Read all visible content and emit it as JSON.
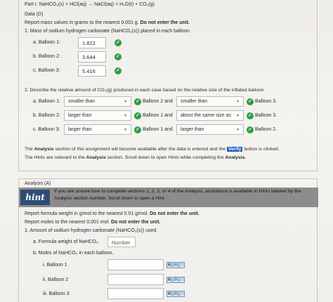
{
  "part1": {
    "heading": "Part I. NaHCO₃(s) + HCl(aq) → NaCl(aq) + H₂O(ℓ) + CO₂(g)",
    "data_label": "Data (D)",
    "report_prefix": "Report mass values in grams to the nearest 0.001 g.",
    "report_bold": "Do not enter the unit.",
    "q1": "1. Mass of sodium hydrogen carbonate (NaHCO₃(s)) placed in each balloon.",
    "masses": [
      {
        "label": "a. Balloon 1:",
        "value": "1.822"
      },
      {
        "label": "b. Balloon 2:",
        "value": "3.644"
      },
      {
        "label": "c. Balloon 3:",
        "value": "5.416"
      }
    ],
    "q2": "2. Describe the relative amount of CO₂(g) produced in each case based on the relative size of the inflated balloon.",
    "comparisons": [
      {
        "label": "a. Balloon 1:",
        "sel1": "smaller than",
        "ref1": "Balloon 2 and",
        "sel2": "smaller than",
        "ref2": "Balloon 3."
      },
      {
        "label": "b. Balloon 2:",
        "sel1": "larger than",
        "ref1": "Balloon 1 and",
        "sel2": "about the same size as",
        "ref2": "Balloon 3."
      },
      {
        "label": "c. Balloon 3:",
        "sel1": "larger than",
        "ref1": "Balloon 1 and",
        "sel2": "larger than",
        "ref2": "Balloon 2."
      }
    ],
    "analysis_note_1a": "The",
    "analysis_note_1b": "Analysis",
    "analysis_note_1c": "section of this assignment will become available after the data is entered and the",
    "verify_label": "Verify",
    "analysis_note_1d": "button is clicked.",
    "analysis_note_2a": "The Hints are relevant to the",
    "analysis_note_2b": "Analysis",
    "analysis_note_2c": "section.  Scroll down to open Hints while completing the",
    "analysis_note_2d": "Analysis."
  },
  "analysis": {
    "heading": "Analysis (A)",
    "hint_logo": "hint",
    "hint_line1": "If you are unsure how to complete sections 1, 2, 3, or 4 of the Analysis, assistance is available in Hints labeled by the",
    "hint_line2": "Analysis section number. Scroll down to open a Hint.",
    "fw_prefix": "Report formula weight in g/mol to the nearest 0.01 g/mol.",
    "fw_bold": "Do not enter the unit.",
    "mol_prefix": "Report moles to the nearest 0.001 mol.",
    "mol_bold": "Do not enter the unit.",
    "q1": "1. Amount of sodium hydrogen carbonate (NaHCO₃(s)) used.",
    "fw_label": "a. Formula weight of NaHCO₃",
    "fw_placeholder": "Number",
    "moles_label": "b. Moles of NaHCO₃ in each balloon.",
    "balloons": [
      {
        "label": "i. Balloon 1"
      },
      {
        "label": "ii. Balloon 2"
      },
      {
        "label": "iii. Balloon 3"
      }
    ]
  },
  "colors": {
    "check_green": "#2f9e44",
    "verify_blue": "#1f5fc9",
    "hint_navy": "#2e4d76",
    "hint_bar_gray": "#8d8c8a"
  }
}
